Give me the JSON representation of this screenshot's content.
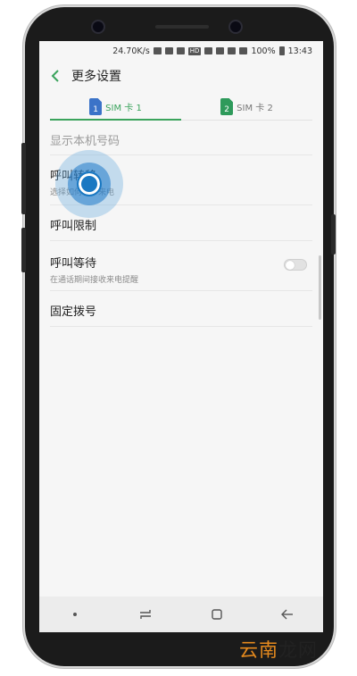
{
  "status_bar": {
    "speed": "24.70K/s",
    "hd": "HD",
    "battery": "100%",
    "time": "13:43"
  },
  "header": {
    "title": "更多设置"
  },
  "tabs": [
    {
      "icon_num": "1",
      "label": "SIM 卡 1"
    },
    {
      "icon_num": "2",
      "label": "SIM 卡 2"
    }
  ],
  "settings": {
    "show_number": "显示本机号码",
    "call_forwarding": {
      "title": "呼叫转移",
      "subtitle": "选择如何转移来电"
    },
    "call_barring": "呼叫限制",
    "call_waiting": {
      "title": "呼叫等待",
      "subtitle": "在通话期间接收来电提醒",
      "enabled": false
    },
    "fixed_dialing": "固定拨号"
  },
  "watermark": {
    "part1": "云南",
    "part2": "龙网"
  },
  "colors": {
    "accent": "#3aa35c",
    "sim1": "#3b73c8",
    "sim2": "#2e9a5b",
    "touch": "#1a78c2",
    "watermark": "#e58a1e"
  }
}
